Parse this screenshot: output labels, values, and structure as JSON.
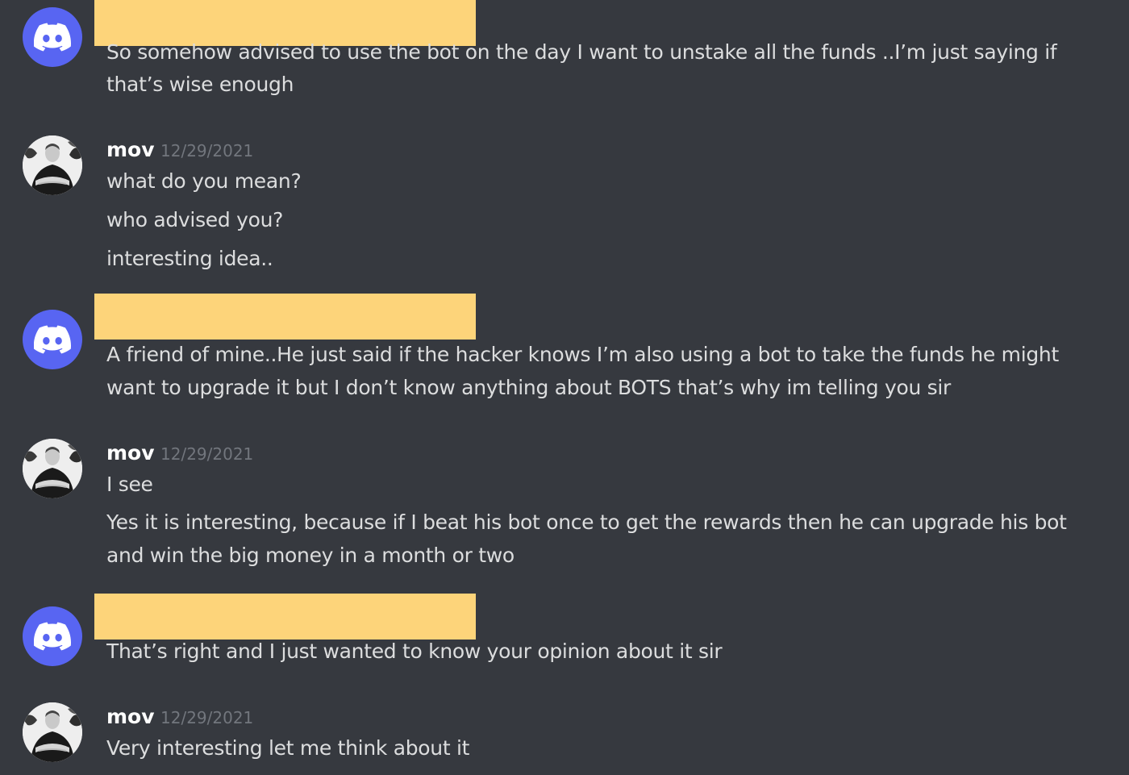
{
  "colors": {
    "background": "#36393f",
    "text": "#dcddde",
    "author": "#ffffff",
    "timestamp": "#72767d",
    "discord_blurple": "#5865f2",
    "redaction": "#fdd47a"
  },
  "messages": [
    {
      "avatar": "discord-logo-icon",
      "lines": [
        "So somehow advised to use the bot on the day I want to unstake all  the funds ..I’m just saying if",
        "that’s wise enough"
      ]
    },
    {
      "author": "mov",
      "timestamp": "12/29/2021",
      "avatar": "user-photo",
      "lines": [
        "what do you mean?",
        "who advised you?",
        "interesting idea.."
      ]
    },
    {
      "avatar": "discord-logo-icon",
      "lines": [
        "A friend of mine..He just said if the hacker knows I’m also using a bot to take the funds he might",
        "want to upgrade it but I don’t know anything about BOTS that’s why im telling you sir"
      ]
    },
    {
      "author": "mov",
      "timestamp": "12/29/2021",
      "avatar": "user-photo",
      "lines": [
        "I see",
        "Yes it is interesting, because if I beat his bot once to get the rewards then he can upgrade his bot",
        "and win the big money in a month or two"
      ]
    },
    {
      "avatar": "discord-logo-icon",
      "lines": [
        "That’s right and I just wanted to know your opinion about it sir"
      ]
    },
    {
      "author": "mov",
      "timestamp": "12/29/2021",
      "avatar": "user-photo",
      "lines": [
        "Very interesting let me think about it"
      ]
    }
  ]
}
